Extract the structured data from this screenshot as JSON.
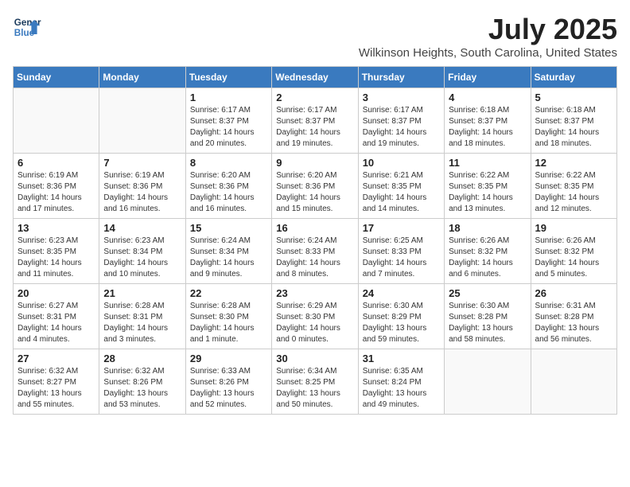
{
  "header": {
    "logo_line1": "General",
    "logo_line2": "Blue",
    "title": "July 2025",
    "subtitle": "Wilkinson Heights, South Carolina, United States"
  },
  "weekdays": [
    "Sunday",
    "Monday",
    "Tuesday",
    "Wednesday",
    "Thursday",
    "Friday",
    "Saturday"
  ],
  "weeks": [
    [
      {
        "day": "",
        "info": ""
      },
      {
        "day": "",
        "info": ""
      },
      {
        "day": "1",
        "info": "Sunrise: 6:17 AM\nSunset: 8:37 PM\nDaylight: 14 hours and 20 minutes."
      },
      {
        "day": "2",
        "info": "Sunrise: 6:17 AM\nSunset: 8:37 PM\nDaylight: 14 hours and 19 minutes."
      },
      {
        "day": "3",
        "info": "Sunrise: 6:17 AM\nSunset: 8:37 PM\nDaylight: 14 hours and 19 minutes."
      },
      {
        "day": "4",
        "info": "Sunrise: 6:18 AM\nSunset: 8:37 PM\nDaylight: 14 hours and 18 minutes."
      },
      {
        "day": "5",
        "info": "Sunrise: 6:18 AM\nSunset: 8:37 PM\nDaylight: 14 hours and 18 minutes."
      }
    ],
    [
      {
        "day": "6",
        "info": "Sunrise: 6:19 AM\nSunset: 8:36 PM\nDaylight: 14 hours and 17 minutes."
      },
      {
        "day": "7",
        "info": "Sunrise: 6:19 AM\nSunset: 8:36 PM\nDaylight: 14 hours and 16 minutes."
      },
      {
        "day": "8",
        "info": "Sunrise: 6:20 AM\nSunset: 8:36 PM\nDaylight: 14 hours and 16 minutes."
      },
      {
        "day": "9",
        "info": "Sunrise: 6:20 AM\nSunset: 8:36 PM\nDaylight: 14 hours and 15 minutes."
      },
      {
        "day": "10",
        "info": "Sunrise: 6:21 AM\nSunset: 8:35 PM\nDaylight: 14 hours and 14 minutes."
      },
      {
        "day": "11",
        "info": "Sunrise: 6:22 AM\nSunset: 8:35 PM\nDaylight: 14 hours and 13 minutes."
      },
      {
        "day": "12",
        "info": "Sunrise: 6:22 AM\nSunset: 8:35 PM\nDaylight: 14 hours and 12 minutes."
      }
    ],
    [
      {
        "day": "13",
        "info": "Sunrise: 6:23 AM\nSunset: 8:35 PM\nDaylight: 14 hours and 11 minutes."
      },
      {
        "day": "14",
        "info": "Sunrise: 6:23 AM\nSunset: 8:34 PM\nDaylight: 14 hours and 10 minutes."
      },
      {
        "day": "15",
        "info": "Sunrise: 6:24 AM\nSunset: 8:34 PM\nDaylight: 14 hours and 9 minutes."
      },
      {
        "day": "16",
        "info": "Sunrise: 6:24 AM\nSunset: 8:33 PM\nDaylight: 14 hours and 8 minutes."
      },
      {
        "day": "17",
        "info": "Sunrise: 6:25 AM\nSunset: 8:33 PM\nDaylight: 14 hours and 7 minutes."
      },
      {
        "day": "18",
        "info": "Sunrise: 6:26 AM\nSunset: 8:32 PM\nDaylight: 14 hours and 6 minutes."
      },
      {
        "day": "19",
        "info": "Sunrise: 6:26 AM\nSunset: 8:32 PM\nDaylight: 14 hours and 5 minutes."
      }
    ],
    [
      {
        "day": "20",
        "info": "Sunrise: 6:27 AM\nSunset: 8:31 PM\nDaylight: 14 hours and 4 minutes."
      },
      {
        "day": "21",
        "info": "Sunrise: 6:28 AM\nSunset: 8:31 PM\nDaylight: 14 hours and 3 minutes."
      },
      {
        "day": "22",
        "info": "Sunrise: 6:28 AM\nSunset: 8:30 PM\nDaylight: 14 hours and 1 minute."
      },
      {
        "day": "23",
        "info": "Sunrise: 6:29 AM\nSunset: 8:30 PM\nDaylight: 14 hours and 0 minutes."
      },
      {
        "day": "24",
        "info": "Sunrise: 6:30 AM\nSunset: 8:29 PM\nDaylight: 13 hours and 59 minutes."
      },
      {
        "day": "25",
        "info": "Sunrise: 6:30 AM\nSunset: 8:28 PM\nDaylight: 13 hours and 58 minutes."
      },
      {
        "day": "26",
        "info": "Sunrise: 6:31 AM\nSunset: 8:28 PM\nDaylight: 13 hours and 56 minutes."
      }
    ],
    [
      {
        "day": "27",
        "info": "Sunrise: 6:32 AM\nSunset: 8:27 PM\nDaylight: 13 hours and 55 minutes."
      },
      {
        "day": "28",
        "info": "Sunrise: 6:32 AM\nSunset: 8:26 PM\nDaylight: 13 hours and 53 minutes."
      },
      {
        "day": "29",
        "info": "Sunrise: 6:33 AM\nSunset: 8:26 PM\nDaylight: 13 hours and 52 minutes."
      },
      {
        "day": "30",
        "info": "Sunrise: 6:34 AM\nSunset: 8:25 PM\nDaylight: 13 hours and 50 minutes."
      },
      {
        "day": "31",
        "info": "Sunrise: 6:35 AM\nSunset: 8:24 PM\nDaylight: 13 hours and 49 minutes."
      },
      {
        "day": "",
        "info": ""
      },
      {
        "day": "",
        "info": ""
      }
    ]
  ]
}
